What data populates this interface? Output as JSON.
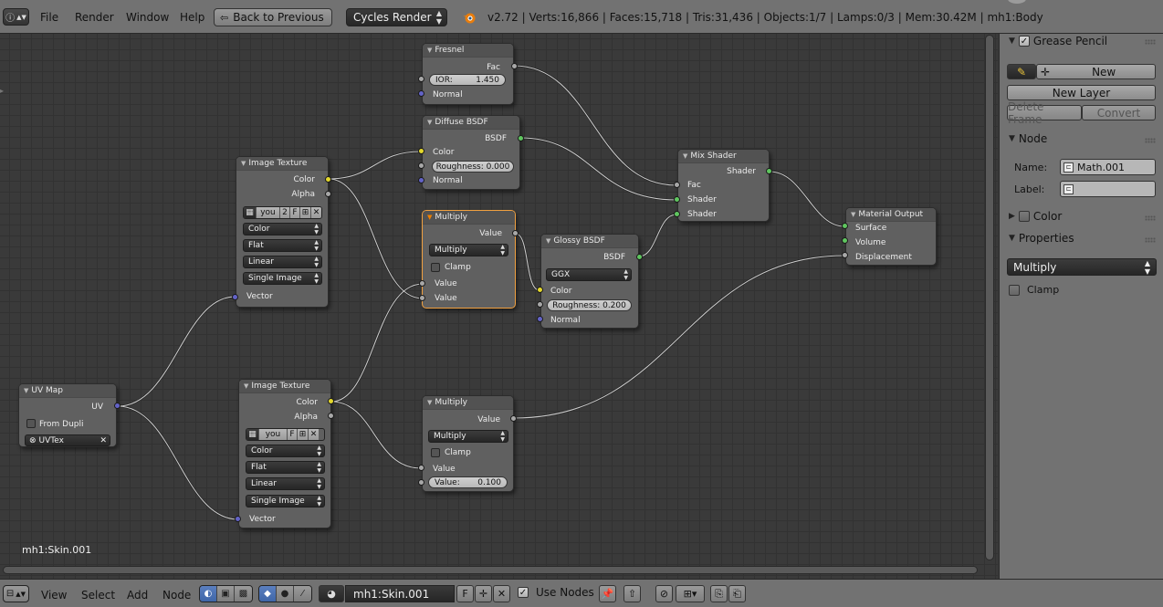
{
  "header": {
    "menus": [
      "File",
      "Render",
      "Window",
      "Help"
    ],
    "back_button": "Back to Previous",
    "render_engine": "Cycles Render",
    "stats": "v2.72 | Verts:16,866 | Faces:15,718 | Tris:31,436 | Objects:1/7 | Lamps:0/3 | Mem:30.42M | mh1:Body"
  },
  "editor": {
    "material_label": "mh1:Skin.001",
    "nodes": {
      "fresnel": {
        "title": "Fresnel",
        "out_fac": "Fac",
        "ior": "IOR:",
        "ior_value": "1.450",
        "in_normal": "Normal"
      },
      "diffuse": {
        "title": "Diffuse BSDF",
        "out_bsdf": "BSDF",
        "in_color": "Color",
        "roughness": "Roughness: 0.000",
        "in_normal": "Normal"
      },
      "image1": {
        "title": "Image Texture",
        "out_color": "Color",
        "out_alpha": "Alpha",
        "img_name": "you",
        "img_users": "2",
        "img_fake": "F",
        "color": "Color",
        "interp": "Flat",
        "proj": "Linear",
        "source": "Single Image",
        "in_vector": "Vector"
      },
      "image2": {
        "title": "Image Texture",
        "out_color": "Color",
        "out_alpha": "Alpha",
        "img_name": "you",
        "img_fake": "F",
        "color": "Color",
        "interp": "Flat",
        "proj": "Linear",
        "source": "Single Image",
        "in_vector": "Vector"
      },
      "multiply1": {
        "title": "Multiply",
        "out_value": "Value",
        "op": "Multiply",
        "clamp": "Clamp",
        "in_value1": "Value",
        "in_value2": "Value"
      },
      "glossy": {
        "title": "Glossy BSDF",
        "out_bsdf": "BSDF",
        "dist": "GGX",
        "in_color": "Color",
        "roughness": "Roughness: 0.200",
        "in_normal": "Normal"
      },
      "mix": {
        "title": "Mix Shader",
        "out_shader": "Shader",
        "in_fac": "Fac",
        "in_shader1": "Shader",
        "in_shader2": "Shader"
      },
      "output": {
        "title": "Material Output",
        "in_surface": "Surface",
        "in_volume": "Volume",
        "in_disp": "Displacement"
      },
      "uvmap": {
        "title": "UV Map",
        "out_uv": "UV",
        "from_dupli": "From Dupli",
        "uv_name": "UVTex"
      },
      "multiply2": {
        "title": "Multiply",
        "out_value": "Value",
        "op": "Multiply",
        "clamp": "Clamp",
        "in_value": "Value",
        "value_field": "Value:",
        "value_num": "0.100"
      }
    }
  },
  "panel": {
    "grease_pencil": {
      "title": "Grease Pencil",
      "new_button": "New",
      "new_layer": "New Layer",
      "delete_frame": "Delete Frame",
      "convert": "Convert"
    },
    "node": {
      "title": "Node",
      "name_label": "Name:",
      "name_value": "Math.001",
      "label_label": "Label:",
      "label_value": ""
    },
    "color": {
      "title": "Color"
    },
    "properties": {
      "title": "Properties",
      "operation": "Multiply",
      "clamp": "Clamp"
    }
  },
  "bottombar": {
    "menus": [
      "View",
      "Select",
      "Add",
      "Node"
    ],
    "material_name": "mh1:Skin.001",
    "fake_user": "F",
    "use_nodes": "Use Nodes"
  },
  "colors": {
    "socket_color": "#e4d82c",
    "socket_value": "#a8a8a8",
    "socket_vector": "#6363c7",
    "socket_shader": "#5fc65f",
    "selected_outline": "#f0a040"
  }
}
